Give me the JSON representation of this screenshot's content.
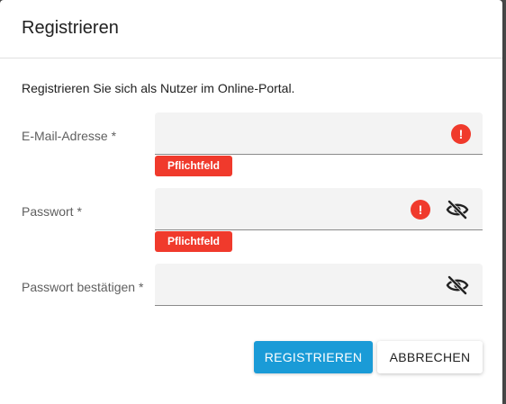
{
  "dialog": {
    "title": "Registrieren",
    "intro": "Registrieren Sie sich als Nutzer im Online-Portal."
  },
  "form": {
    "email": {
      "label": "E-Mail-Adresse *",
      "value": "",
      "error": "Pflichtfeld",
      "icons": [
        "error-icon"
      ]
    },
    "password": {
      "label": "Passwort *",
      "value": "",
      "error": "Pflichtfeld",
      "icons": [
        "error-icon",
        "eye-off-icon"
      ]
    },
    "password_confirm": {
      "label": "Passwort bestätigen *",
      "value": "",
      "icons": [
        "eye-off-icon"
      ]
    }
  },
  "actions": {
    "register_label": "REGISTRIEREN",
    "cancel_label": "ABBRECHEN"
  },
  "colors": {
    "primary": "#1a9bd7",
    "error": "#f03a2c",
    "field_bg": "#f3f3f3"
  }
}
